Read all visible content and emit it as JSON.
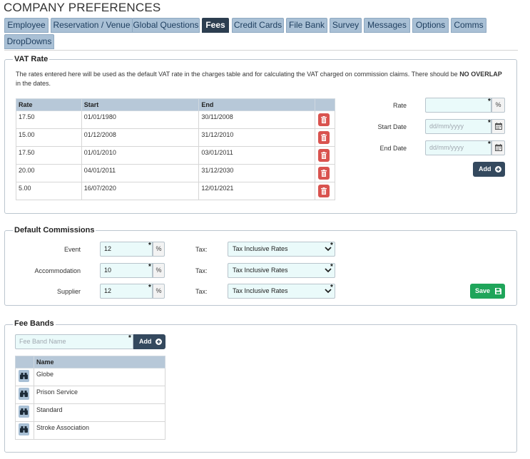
{
  "page_title": "COMPANY PREFERENCES",
  "tabs": [
    {
      "label": "Employee"
    },
    {
      "label": "Reservation / Venue"
    },
    {
      "label": "Global Questions"
    },
    {
      "label": "Fees",
      "active": true
    },
    {
      "label": "Credit Cards"
    },
    {
      "label": "File Bank"
    },
    {
      "label": "Survey"
    },
    {
      "label": "Messages"
    },
    {
      "label": "Options"
    },
    {
      "label": "Comms"
    },
    {
      "label": "DropDowns"
    }
  ],
  "vat": {
    "legend": "VAT Rate",
    "note_before": "The rates entered here will be used as the default VAT rate in the charges table and for calculating the VAT charged on commission claims. There should be ",
    "note_bold": "NO OVERLAP",
    "note_after": " in the dates.",
    "columns": [
      "Rate",
      "Start",
      "End"
    ],
    "rows": [
      {
        "rate": "17.50",
        "start": "01/01/1980",
        "end": "30/11/2008"
      },
      {
        "rate": "15.00",
        "start": "01/12/2008",
        "end": "31/12/2010"
      },
      {
        "rate": "17.50",
        "start": "01/01/2010",
        "end": "03/01/2011"
      },
      {
        "rate": "20.00",
        "start": "04/01/2011",
        "end": "31/12/2030"
      },
      {
        "rate": "5.00",
        "start": "16/07/2020",
        "end": "12/01/2021"
      }
    ],
    "form": {
      "rate_label": "Rate",
      "rate_value": "",
      "rate_unit": "%",
      "start_label": "Start Date",
      "start_placeholder": "dd/mm/yyyy",
      "end_label": "End Date",
      "end_placeholder": "dd/mm/yyyy",
      "add_label": "Add"
    }
  },
  "commissions": {
    "legend": "Default Commissions",
    "unit": "%",
    "tax_label": "Tax:",
    "rows": [
      {
        "label": "Event",
        "value": "12",
        "tax": "Tax Inclusive Rates"
      },
      {
        "label": "Accommodation",
        "value": "10",
        "tax": "Tax Inclusive Rates"
      },
      {
        "label": "Supplier",
        "value": "12",
        "tax": "Tax Inclusive Rates"
      }
    ],
    "save_label": "Save"
  },
  "fee_bands": {
    "legend": "Fee Bands",
    "input_placeholder": "Fee Band Name",
    "add_label": "Add",
    "column": "Name",
    "rows": [
      {
        "name": "Globe"
      },
      {
        "name": "Prison Service"
      },
      {
        "name": "Standard"
      },
      {
        "name": "Stroke Association"
      }
    ]
  },
  "colors": {
    "tab": "#a9c0d5",
    "tab_active": "#2c3e50",
    "delete": "#d9534f",
    "save": "#1fa55a",
    "input_bg": "#eafafa"
  },
  "icons": {
    "delete": "trash-icon",
    "calendar": "calendar-icon",
    "add": "plus-circle-icon",
    "save": "floppy-disk-icon",
    "view": "binoculars-icon",
    "dropdown": "chevron-down-icon"
  }
}
